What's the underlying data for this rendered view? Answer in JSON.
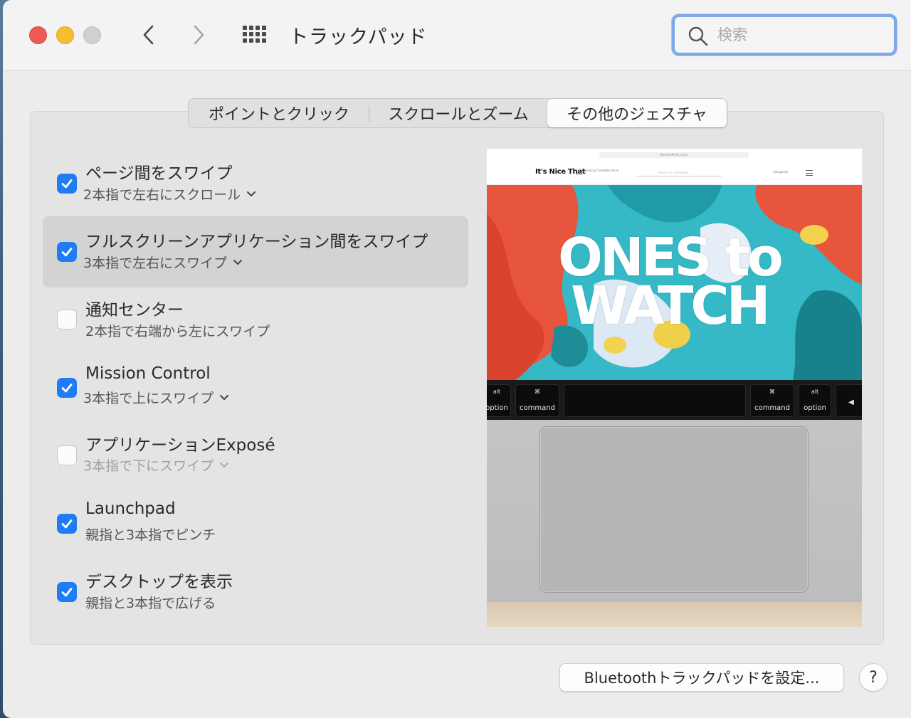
{
  "window": {
    "title": "トラックパッド"
  },
  "search": {
    "placeholder": "検索",
    "value": ""
  },
  "tabs": [
    {
      "label": "ポイントとクリック",
      "active": false
    },
    {
      "label": "スクロールとズーム",
      "active": false
    },
    {
      "label": "その他のジェスチャ",
      "active": true
    }
  ],
  "options": [
    {
      "title": "ページ間をスワイプ",
      "subtitle": "2本指で左右にスクロール",
      "checked": true,
      "has_menu": true,
      "selected": false
    },
    {
      "title": "フルスクリーンアプリケーション間をスワイプ",
      "subtitle": "3本指で左右にスワイプ",
      "checked": true,
      "has_menu": true,
      "selected": true
    },
    {
      "title": "通知センター",
      "subtitle": "2本指で右端から左にスワイプ",
      "checked": false,
      "has_menu": false,
      "selected": false
    },
    {
      "title": "Mission Control",
      "subtitle": "3本指で上にスワイプ",
      "checked": true,
      "has_menu": true,
      "selected": false
    },
    {
      "title": "アプリケーションExposé",
      "subtitle": "3本指で下にスワイプ",
      "checked": false,
      "has_menu": true,
      "selected": false,
      "dimmed": true
    },
    {
      "title": "Launchpad",
      "subtitle": "親指と3本指でピンチ",
      "checked": true,
      "has_menu": false,
      "selected": false
    },
    {
      "title": "デスクトップを表示",
      "subtitle": "親指と3本指で広げる",
      "checked": true,
      "has_menu": false,
      "selected": false
    }
  ],
  "preview": {
    "site_logo": "It's Nice That",
    "site_tagline": "Championing Creativity Since 2007",
    "site_url": "itsnicethat.com",
    "site_search": "Search for something",
    "site_categories": "Categories",
    "hero_line1": "ONES to",
    "hero_line2": "WATCH",
    "keys": [
      {
        "top": "alt",
        "bottom": "option"
      },
      {
        "top": "⌘",
        "bottom": "command"
      },
      {
        "top": "⌘",
        "bottom": "command"
      },
      {
        "top": "alt",
        "bottom": "option"
      },
      {
        "top": "",
        "bottom": "◀"
      }
    ]
  },
  "footer": {
    "bluetooth_button": "Bluetoothトラックパッドを設定...",
    "help_button": "?"
  },
  "colors": {
    "accent": "#1f7cf5",
    "close": "#ee5b56",
    "minimize": "#f6be2f",
    "zoom_disabled": "#d0d0d0",
    "search_focus": "#7ea8e6"
  }
}
